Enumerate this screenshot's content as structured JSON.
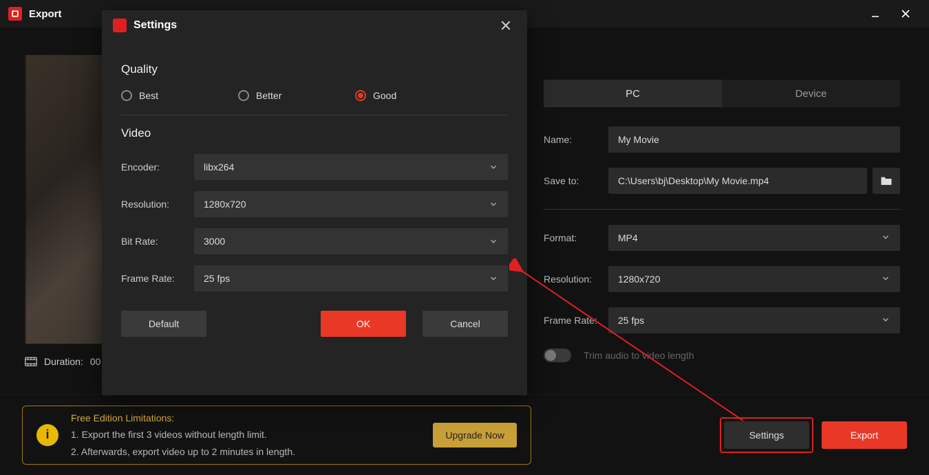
{
  "window": {
    "title": "Export"
  },
  "preview": {
    "duration_label": "Duration:",
    "duration_value": "00"
  },
  "tabs": {
    "pc": "PC",
    "device": "Device"
  },
  "fields": {
    "name_label": "Name:",
    "name_value": "My Movie",
    "save_label": "Save to:",
    "save_value": "C:\\Users\\bj\\Desktop\\My Movie.mp4",
    "format_label": "Format:",
    "format_value": "MP4",
    "resolution_label": "Resolution:",
    "resolution_value": "1280x720",
    "framerate_label": "Frame Rate:",
    "framerate_value": "25 fps",
    "trim_label": "Trim audio to video length"
  },
  "limitations": {
    "title": "Free Edition Limitations:",
    "line1": "1. Export the first 3 videos without length limit.",
    "line2": "2. Afterwards, export video up to 2 minutes in length.",
    "upgrade": "Upgrade Now"
  },
  "buttons": {
    "settings": "Settings",
    "export": "Export"
  },
  "modal": {
    "title": "Settings",
    "quality_h": "Quality",
    "q_best": "Best",
    "q_better": "Better",
    "q_good": "Good",
    "video_h": "Video",
    "encoder_label": "Encoder:",
    "encoder_value": "libx264",
    "resolution_label": "Resolution:",
    "resolution_value": "1280x720",
    "bitrate_label": "Bit Rate:",
    "bitrate_value": "3000",
    "framerate_label": "Frame Rate:",
    "framerate_value": "25 fps",
    "default": "Default",
    "ok": "OK",
    "cancel": "Cancel"
  }
}
